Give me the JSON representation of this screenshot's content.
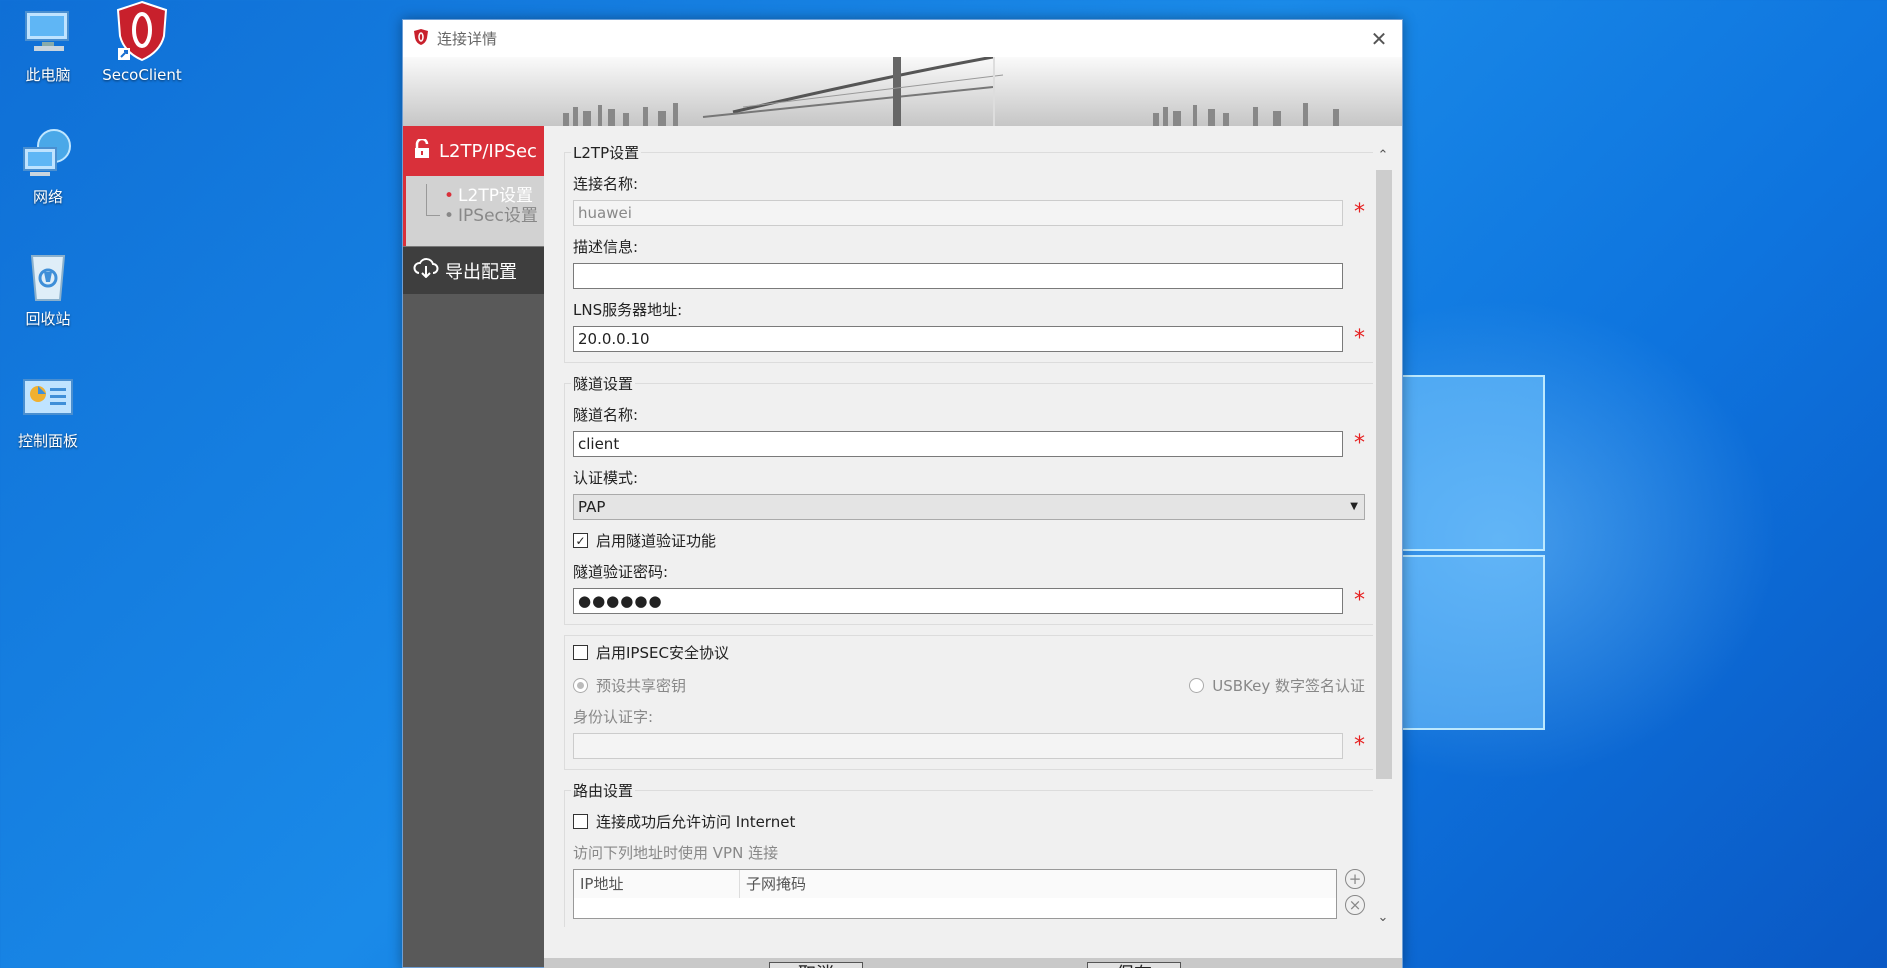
{
  "desktop": {
    "icons": [
      {
        "label": "此电脑"
      },
      {
        "label": "SecoClient"
      },
      {
        "label": "网络"
      },
      {
        "label": "回收站"
      },
      {
        "label": "控制面板"
      }
    ]
  },
  "dialog": {
    "title": "连接详情",
    "close_icon": "close-icon",
    "sidebar": {
      "main_label": "L2TP/IPSec",
      "sub_items": [
        {
          "label": "L2TP设置"
        },
        {
          "label": "IPSec设置"
        }
      ],
      "export_label": "导出配置"
    },
    "l2tp": {
      "legend": "L2TP设置",
      "conn_name_label": "连接名称:",
      "conn_name_value": "huawei",
      "desc_label": "描述信息:",
      "desc_value": "",
      "lns_label": "LNS服务器地址:",
      "lns_value": "20.0.0.10"
    },
    "tunnel": {
      "legend": "隧道设置",
      "name_label": "隧道名称:",
      "name_value": "client",
      "auth_label": "认证模式:",
      "auth_value": "PAP",
      "enable_auth_label": "启用隧道验证功能",
      "enable_auth_checked": true,
      "pwd_label": "隧道验证密码:",
      "pwd_value": "●●●●●●"
    },
    "ipsec": {
      "enable_label": "启用IPSEC安全协议",
      "enable_checked": false,
      "psk_label": "预设共享密钥",
      "usbkey_label": "USBKey 数字签名认证",
      "identity_label": "身份认证字:",
      "identity_value": ""
    },
    "route": {
      "legend": "路由设置",
      "allow_internet_label": "连接成功后允许访问 Internet",
      "allow_internet_checked": false,
      "vpn_hint": "访问下列地址时使用 VPN 连接",
      "col_ip": "IP地址",
      "col_mask": "子网掩码"
    },
    "required_mark": "*",
    "buttons": {
      "cancel": "取消",
      "save": "保存"
    }
  },
  "colors": {
    "accent_red": "#d9303a",
    "required_red": "#e62020"
  }
}
